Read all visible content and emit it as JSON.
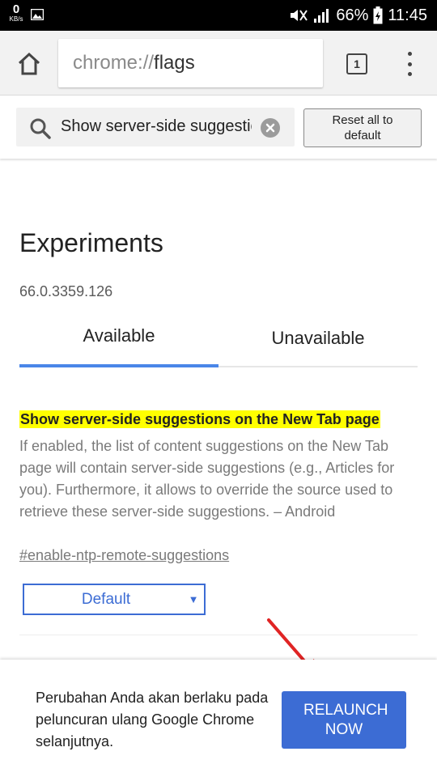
{
  "status_bar": {
    "data_speed": "0",
    "data_unit": "KB/s",
    "battery": "66%",
    "time": "11:45"
  },
  "toolbar": {
    "url_scheme": "chrome://",
    "url_host": "flags",
    "tab_count": "1"
  },
  "search": {
    "value": "Show server-side suggestions",
    "reset_label": "Reset all to default"
  },
  "page": {
    "title": "Experiments",
    "version": "66.0.3359.126",
    "tabs": [
      {
        "label": "Available",
        "selected": true
      },
      {
        "label": "Unavailable",
        "selected": false
      }
    ]
  },
  "experiment": {
    "title": "Show server-side suggestions on the New Tab page",
    "description": "If enabled, the list of content suggestions on the New Tab page will contain server-side suggestions (e.g., Articles for you). Furthermore, it allows to override the source used to retrieve these server-side suggestions. – Android",
    "link": "#enable-ntp-remote-suggestions",
    "selected_option": "Default"
  },
  "banner": {
    "message": "Perubahan Anda akan berlaku pada peluncuran ulang Google Chrome selanjutnya.",
    "button_label": "RELAUNCH NOW"
  },
  "colors": {
    "accent": "#3c6cd4",
    "tab_indicator": "#4a86e8",
    "highlight": "#ffff00",
    "annotation_arrow": "#e02424"
  },
  "icons": {
    "status": [
      "image-icon",
      "mute-icon",
      "signal-icon",
      "battery-charging-icon"
    ],
    "toolbar": [
      "home-icon",
      "tab-switcher-icon",
      "overflow-menu-icon"
    ],
    "search": [
      "search-icon",
      "clear-icon"
    ],
    "select": [
      "dropdown-arrow-icon"
    ]
  }
}
